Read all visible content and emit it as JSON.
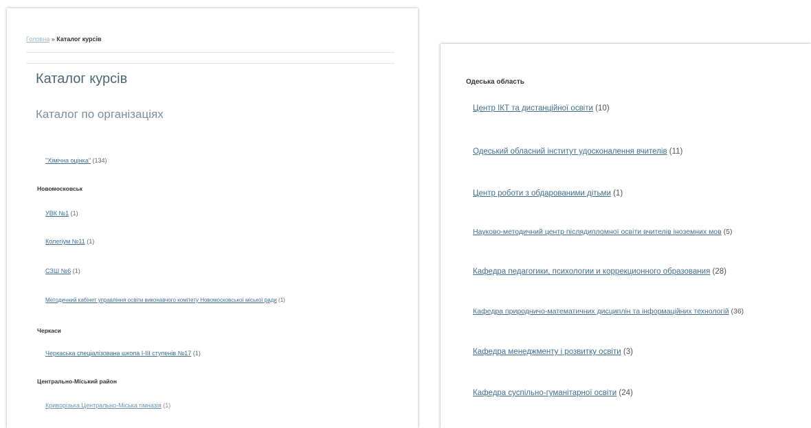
{
  "breadcrumb": {
    "home": "Головна",
    "separator": "»",
    "current": "Каталог курсів"
  },
  "page": {
    "title": "Каталог курсів",
    "subtitle": "Каталог по організаціях"
  },
  "left": {
    "top_org": {
      "name": "\"Хімічна оцінка\"",
      "count": "(134)"
    },
    "regions": [
      {
        "name": "Новомосковськ",
        "orgs": [
          {
            "name": "УВК №1",
            "count": "(1)"
          },
          {
            "name": "Колегіум №11",
            "count": "(1)"
          },
          {
            "name": "СЗШ №6",
            "count": "(1)"
          },
          {
            "name": "Методичний кабінет управління освіти виконавчого комітету Новомосковської міської ради",
            "count": "(1)"
          }
        ]
      },
      {
        "name": "Черкаси",
        "orgs": [
          {
            "name": "Черкаська спеціалізована школа І-ІІІ ступенів №17",
            "count": "(1)"
          }
        ]
      },
      {
        "name": "Центрально-Міський район",
        "orgs": [
          {
            "name": "Криворізька Центрально-Міська гімназія",
            "count": "(1)"
          }
        ]
      }
    ]
  },
  "right": {
    "region": "Одеська область",
    "orgs": [
      {
        "name": "Центр ІКТ та дистанційної освіти",
        "count": "(10)"
      },
      {
        "name": "Одеський обласний інститут удосконалення вчителів",
        "count": "(11)"
      },
      {
        "name": "Центр роботи з обдарованими дітьми",
        "count": "(1)"
      },
      {
        "name": "Науково-методичний центр післядипломної освіти вчителів іноземних мов",
        "count": "(5)"
      },
      {
        "name": "Кафедра педагогики, психологии и коррекционного образования",
        "count": "(28)"
      },
      {
        "name": "Кафедра природничо-математичних дисциплін та інформаційних технологій",
        "count": "(36)"
      },
      {
        "name": "Кафедра менеджменту і розвитку освіти",
        "count": "(3)"
      },
      {
        "name": "Кафедра суспільно-гуманітарної освіти",
        "count": "(24)"
      }
    ]
  }
}
